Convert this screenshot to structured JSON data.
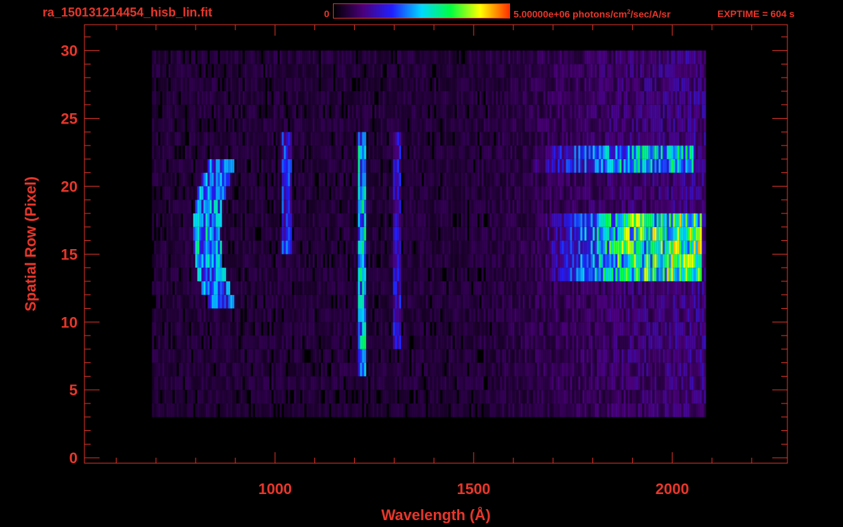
{
  "header": {
    "file_name": "ra_150131214454_hisb_lin.fit",
    "colorbar_min": "0",
    "colorbar_max_value": "5.00000e+06",
    "colorbar_units_pre": "photons/cm",
    "colorbar_units_sup": "2",
    "colorbar_units_post": "/sec/A/sr",
    "exptime": "EXPTIME = 604 s"
  },
  "colors": {
    "background": "#000000",
    "axis": "#e8362a",
    "colormap": [
      "#000000",
      "#4a007a",
      "#2020ff",
      "#00d8ff",
      "#00ff40",
      "#ffff00",
      "#ff3000"
    ]
  },
  "chart_data": {
    "type": "heatmap",
    "title": "ra_150131214454_hisb_lin.fit",
    "xlabel": "Wavelength (Å)",
    "ylabel": "Spatial Row (Pixel)",
    "xlim": [
      520,
      2290
    ],
    "ylim": [
      -0.4,
      31.9
    ],
    "x_ticks": [
      1000,
      1500,
      2000
    ],
    "y_ticks": [
      0,
      5,
      10,
      15,
      20,
      25,
      30
    ],
    "x_minor_step": 100,
    "y_minor_step": 1,
    "grid": false,
    "colorbar_range": [
      0,
      5000000
    ],
    "colorbar_units": "photons/cm^2/sec/A/sr",
    "exptime_s": 604,
    "data_extent": {
      "x": [
        690,
        2080
      ],
      "rows": [
        3,
        30
      ]
    },
    "features": [
      {
        "label": "continuum band",
        "x_range": [
          1680,
          2070
        ],
        "rows": [
          13,
          18
        ],
        "peak_level": 0.55
      },
      {
        "label": "upper continuum band",
        "x_range": [
          1650,
          2050
        ],
        "rows": [
          21,
          23
        ],
        "peak_level": 0.4
      },
      {
        "label": "bright emission line",
        "x": 1216,
        "rows": [
          6,
          24
        ],
        "peak_level": 0.45
      },
      {
        "label": "arc feature",
        "x_range": [
          790,
          900
        ],
        "rows": [
          11,
          22
        ],
        "peak_level": 0.45
      },
      {
        "label": "emission line",
        "x": 1026,
        "rows": [
          15,
          24
        ],
        "peak_level": 0.3
      },
      {
        "label": "emission line",
        "x": 1304,
        "rows": [
          8,
          24
        ],
        "peak_level": 0.25
      }
    ]
  }
}
